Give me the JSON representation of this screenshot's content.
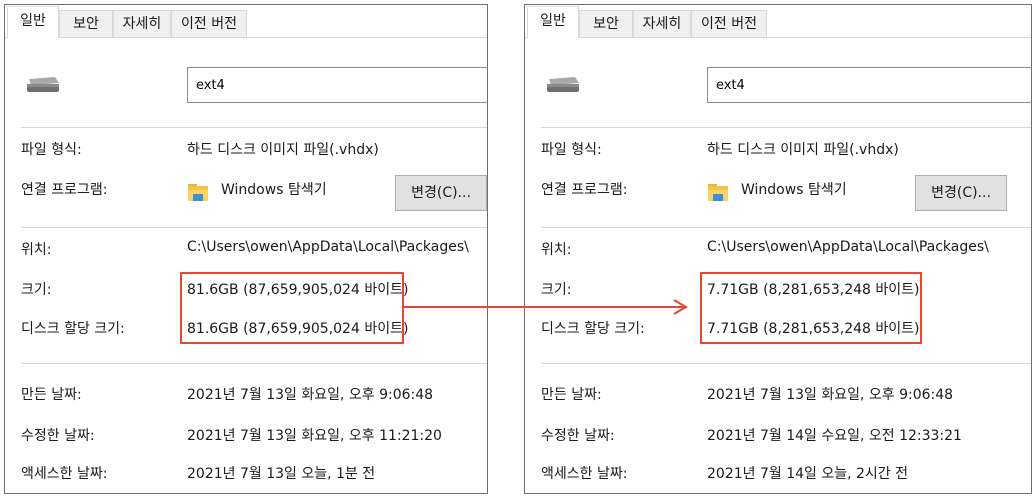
{
  "colors": {
    "highlight": "#e4472f",
    "arrow": "#e4472f"
  },
  "icons": {
    "drive": "drive-icon",
    "opener": "folder-icon"
  },
  "before": {
    "tabs": [
      "일반",
      "보안",
      "자세히",
      "이전 버전"
    ],
    "name": "ext4",
    "file_type_label": "파일 형식:",
    "file_type_value": "하드 디스크 이미지 파일(.vhdx)",
    "opens_with_label": "연결 프로그램:",
    "opens_with_value": "Windows 탐색기",
    "change_button": "변경(C)...",
    "location_label": "위치:",
    "location_value": "C:\\Users\\owen\\AppData\\Local\\Packages\\",
    "size_label": "크기:",
    "size_value": "81.6GB (87,659,905,024 바이트)",
    "size_on_disk_label": "디스크 할당 크기:",
    "size_on_disk_value": "81.6GB (87,659,905,024 바이트)",
    "created_label": "만든 날짜:",
    "created_value": "2021년 7월 13일 화요일, 오후 9:06:48",
    "modified_label": "수정한 날짜:",
    "modified_value": "2021년 7월 13일 화요일, 오후 11:21:20",
    "accessed_label": "액세스한 날짜:",
    "accessed_value": "2021년 7월 13일 오늘, 1분 전"
  },
  "after": {
    "tabs": [
      "일반",
      "보안",
      "자세히",
      "이전 버전"
    ],
    "name": "ext4",
    "file_type_label": "파일 형식:",
    "file_type_value": "하드 디스크 이미지 파일(.vhdx)",
    "opens_with_label": "연결 프로그램:",
    "opens_with_value": "Windows 탐색기",
    "change_button": "변경(C)...",
    "location_label": "위치:",
    "location_value": "C:\\Users\\owen\\AppData\\Local\\Packages\\",
    "size_label": "크기:",
    "size_value": "7.71GB (8,281,653,248 바이트)",
    "size_on_disk_label": "디스크 할당 크기:",
    "size_on_disk_value": "7.71GB (8,281,653,248 바이트)",
    "created_label": "만든 날짜:",
    "created_value": "2021년 7월 13일 화요일, 오후 9:06:48",
    "modified_label": "수정한 날짜:",
    "modified_value": "2021년 7월 14일 수요일, 오전 12:33:21",
    "accessed_label": "액세스한 날짜:",
    "accessed_value": "2021년 7월 14일 오늘, 2시간 전"
  }
}
